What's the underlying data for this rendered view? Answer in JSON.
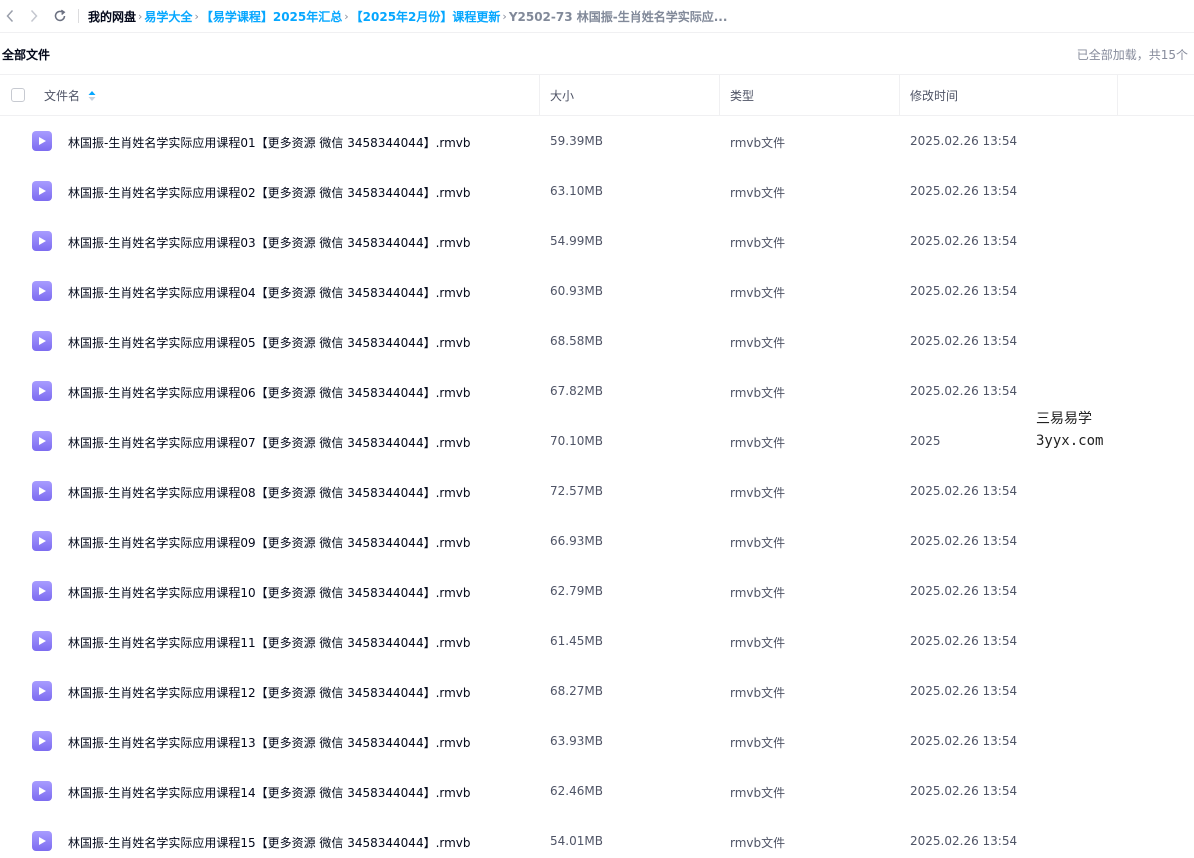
{
  "breadcrumb": {
    "root": "我的网盘",
    "items": [
      "易学大全",
      "【易学课程】2025年汇总",
      "【2025年2月份】课程更新"
    ],
    "current": "Y2502-73 林国振-生肖姓名学实际应..."
  },
  "header": {
    "title": "全部文件",
    "loaded_info": "已全部加载，共15个"
  },
  "columns": {
    "name": "文件名",
    "size": "大小",
    "type": "类型",
    "mtime": "修改时间"
  },
  "files": [
    {
      "name": "林国振-生肖姓名学实际应用课程01【更多资源 微信 3458344044】.rmvb",
      "size": "59.39MB",
      "type": "rmvb文件",
      "mtime": "2025.02.26 13:54"
    },
    {
      "name": "林国振-生肖姓名学实际应用课程02【更多资源 微信 3458344044】.rmvb",
      "size": "63.10MB",
      "type": "rmvb文件",
      "mtime": "2025.02.26 13:54"
    },
    {
      "name": "林国振-生肖姓名学实际应用课程03【更多资源 微信 3458344044】.rmvb",
      "size": "54.99MB",
      "type": "rmvb文件",
      "mtime": "2025.02.26 13:54"
    },
    {
      "name": "林国振-生肖姓名学实际应用课程04【更多资源 微信 3458344044】.rmvb",
      "size": "60.93MB",
      "type": "rmvb文件",
      "mtime": "2025.02.26 13:54"
    },
    {
      "name": "林国振-生肖姓名学实际应用课程05【更多资源 微信 3458344044】.rmvb",
      "size": "68.58MB",
      "type": "rmvb文件",
      "mtime": "2025.02.26 13:54"
    },
    {
      "name": "林国振-生肖姓名学实际应用课程06【更多资源 微信 3458344044】.rmvb",
      "size": "67.82MB",
      "type": "rmvb文件",
      "mtime": "2025.02.26 13:54"
    },
    {
      "name": "林国振-生肖姓名学实际应用课程07【更多资源 微信 3458344044】.rmvb",
      "size": "70.10MB",
      "type": "rmvb文件",
      "mtime": "2025"
    },
    {
      "name": "林国振-生肖姓名学实际应用课程08【更多资源 微信 3458344044】.rmvb",
      "size": "72.57MB",
      "type": "rmvb文件",
      "mtime": "2025.02.26 13:54"
    },
    {
      "name": "林国振-生肖姓名学实际应用课程09【更多资源 微信 3458344044】.rmvb",
      "size": "66.93MB",
      "type": "rmvb文件",
      "mtime": "2025.02.26 13:54"
    },
    {
      "name": "林国振-生肖姓名学实际应用课程10【更多资源 微信 3458344044】.rmvb",
      "size": "62.79MB",
      "type": "rmvb文件",
      "mtime": "2025.02.26 13:54"
    },
    {
      "name": "林国振-生肖姓名学实际应用课程11【更多资源 微信 3458344044】.rmvb",
      "size": "61.45MB",
      "type": "rmvb文件",
      "mtime": "2025.02.26 13:54"
    },
    {
      "name": "林国振-生肖姓名学实际应用课程12【更多资源 微信 3458344044】.rmvb",
      "size": "68.27MB",
      "type": "rmvb文件",
      "mtime": "2025.02.26 13:54"
    },
    {
      "name": "林国振-生肖姓名学实际应用课程13【更多资源 微信 3458344044】.rmvb",
      "size": "63.93MB",
      "type": "rmvb文件",
      "mtime": "2025.02.26 13:54"
    },
    {
      "name": "林国振-生肖姓名学实际应用课程14【更多资源 微信 3458344044】.rmvb",
      "size": "62.46MB",
      "type": "rmvb文件",
      "mtime": "2025.02.26 13:54"
    },
    {
      "name": "林国振-生肖姓名学实际应用课程15【更多资源 微信 3458344044】.rmvb",
      "size": "54.01MB",
      "type": "rmvb文件",
      "mtime": "2025.02.26 13:54"
    }
  ],
  "watermark": {
    "line1": "三易易学",
    "line2": "3yyx.com"
  },
  "icons": {
    "file": "video-file-icon",
    "back": "chevron-left-icon",
    "forward": "chevron-right-icon",
    "refresh": "refresh-icon",
    "sort": "sort-ascending-icon"
  },
  "colors": {
    "link": "#06a7ff",
    "file_icon": "#8b7cf6"
  }
}
